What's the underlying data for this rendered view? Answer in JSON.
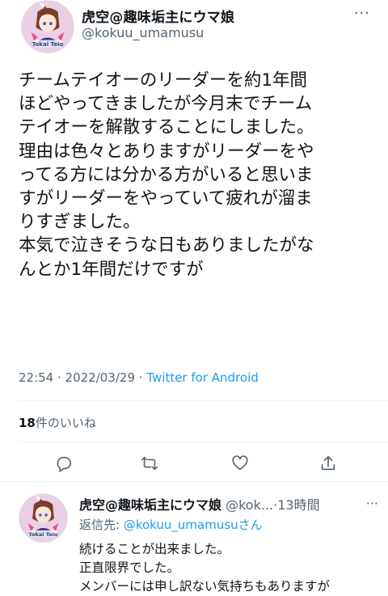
{
  "tweet": {
    "display_name": "虎空@趣味垢主にウマ娘",
    "handle": "@kokuu_umamusu",
    "avatar_text": "Tokai Teio",
    "body_lines": [
      "チームテイオーのリーダーを約1年間",
      "ほどやってきましたが今月末でチーム",
      "テイオーを解散することにしました。",
      "理由は色々とありますがリーダーをや",
      "ってる方には分かる方がいると思いま",
      "すがリーダーをやっていて疲れが溜ま",
      "りすぎました。",
      "本気で泣きそうな日もありましたがな",
      "んとか1年間だけですが"
    ],
    "time": "22:54",
    "separator": " · ",
    "date": "2022/03/29",
    "via": "Twitter for Android",
    "likes_count": "18",
    "likes_label": "件のいいね"
  },
  "actions": {
    "icons": [
      "reply-icon",
      "retweet-icon",
      "like-icon",
      "share-icon"
    ]
  },
  "reply": {
    "display_name": "虎空@趣味垢主にウマ娘",
    "handle": "@kok...",
    "dot": "·",
    "time": "13時間",
    "reply_to_label": "返信先: ",
    "reply_to_handle": "@kokuu_umamusuさん",
    "body_lines": [
      "続けることが出来ました。",
      "正直限界でした。",
      "メンバーには申し訳ない気持ちもありますが"
    ]
  },
  "colors": {
    "link": "#1d9bf0",
    "secondary_text": "#536471",
    "primary_text": "#0f1419",
    "divider": "#eff3f4"
  }
}
